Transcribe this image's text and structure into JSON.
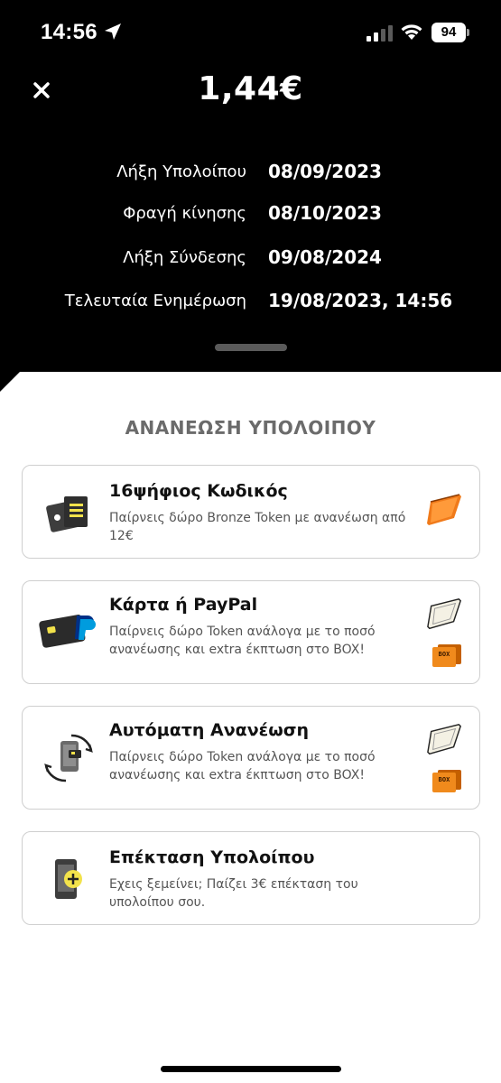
{
  "status_bar": {
    "time": "14:56",
    "battery": "94",
    "icons": [
      "location-arrow-icon",
      "cellular-signal-icon",
      "wifi-icon",
      "battery-icon"
    ]
  },
  "header": {
    "close_icon": "close-icon",
    "balance": "1,44€"
  },
  "info": [
    {
      "label": "Λήξη Υπολοίπου",
      "value": "08/09/2023"
    },
    {
      "label": "Φραγή κίνησης",
      "value": "08/10/2023"
    },
    {
      "label": "Λήξη Σύνδεσης",
      "value": "09/08/2024"
    },
    {
      "label": "Τελευταία Ενημέρωση",
      "value": "19/08/2023, 14:56"
    }
  ],
  "section_title": "ΑΝΑΝΕΩΣΗ ΥΠΟΛΟΙΠΟΥ",
  "cards": [
    {
      "title": "16ψήφιος Κωδικός",
      "desc": "Παίρνεις δώρο Bronze Token με ανανέωση από 12€",
      "icon": "voucher-code-icon",
      "badges": [
        "bronze-token-icon"
      ]
    },
    {
      "title": "Κάρτα ή PayPal",
      "desc": "Παίρνεις δώρο Token ανάλογα με το ποσό ανανέωσης και extra έκπτωση στο BOX!",
      "icon": "card-paypal-icon",
      "badges": [
        "token-icon",
        "box-icon"
      ],
      "box_text": "BOX"
    },
    {
      "title": "Αυτόματη Ανανέωση",
      "desc": "Παίρνεις δώρο Token ανάλογα με το ποσό ανανέωσης και extra έκπτωση στο BOX!",
      "icon": "auto-renew-phone-icon",
      "badges": [
        "token-icon",
        "box-icon"
      ],
      "box_text": "BOX"
    },
    {
      "title": "Επέκταση Υπολοίπου",
      "desc": "Εχεις ξεμείνει; Παίζει 3€ επέκταση του υπολοίπου σου.",
      "icon": "phone-plus-icon",
      "badges": []
    }
  ],
  "colors": {
    "header_bg": "#000000",
    "section_title": "#6b6b6b",
    "bronze": "#f07a1a",
    "box_orange": "#f08a1c",
    "paypal_dark": "#003087",
    "paypal_light": "#009cde",
    "chip_yellow": "#f2e24b"
  }
}
